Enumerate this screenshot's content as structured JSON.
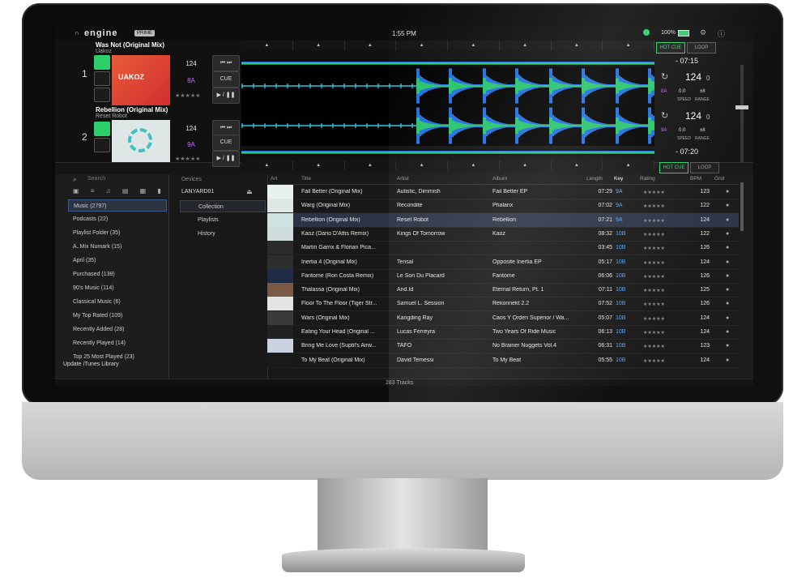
{
  "app": {
    "logo": "engine",
    "logo_tag": "PRIME",
    "clock": "1:55 PM",
    "battery": "100%"
  },
  "decks": [
    {
      "num": "1",
      "title": "Was Not (Original Mix)",
      "artist": "Uakoz",
      "bpm": "124",
      "key": "8A",
      "cue": "CUE",
      "play": "▶ / ❚❚",
      "time": "- 07:15",
      "bpm_display": "124",
      "bpm_dec": "0",
      "key_label": "8A",
      "speed_val": "0.0",
      "range_val": "±8",
      "speed": "SPEED",
      "range": "RANGE",
      "hotcue": "HOT CUE",
      "loop": "LOOP",
      "art_text": "UAKOZ"
    },
    {
      "num": "2",
      "title": "Rebellion (Original Mix)",
      "artist": "Reset Robot",
      "bpm": "124",
      "key": "9A",
      "cue": "CUE",
      "play": "▶ / ❚❚",
      "time": "- 07:20",
      "bpm_display": "124",
      "bpm_dec": "0",
      "key_label": "9A",
      "speed_val": "0.0",
      "range_val": "±8",
      "speed": "SPEED",
      "range": "RANGE",
      "hotcue": "HOT CUE",
      "loop": "LOOP"
    }
  ],
  "browser": {
    "search_placeholder": "Search",
    "library": [
      "Music (2797)",
      "Podcasts (22)",
      "Playlist Folder (35)",
      "A..Mix Numark (15)",
      "April (35)",
      "Purchased (138)",
      "90's Music (114)",
      "Classical Music (6)",
      "My Top Rated (109)",
      "Recently Added (28)",
      "Recently Played (14)",
      "Top 25 Most Played (23)"
    ],
    "update": "Update iTunes Library",
    "devices_header": "Devices",
    "device_name": "LANYARD01",
    "device_items": [
      "Collection",
      "Playlists",
      "History"
    ],
    "columns": {
      "art": "Art",
      "title": "Title",
      "artist": "Artist",
      "album": "Album",
      "length": "Length",
      "key": "Key",
      "rating": "Rating",
      "bpm": "BPM",
      "grid": "Grid"
    },
    "tracks": [
      {
        "title": "Fail Better (Original Mix)",
        "artist": "Autistic, Dimmish",
        "album": "Fail Better EP",
        "length": "07:29",
        "key": "9A",
        "bpm": "123"
      },
      {
        "title": "Warg (Original Mix)",
        "artist": "Recondite",
        "album": "Phalanx",
        "length": "07:02",
        "key": "9A",
        "bpm": "122"
      },
      {
        "title": "Rebellion (Original Mix)",
        "artist": "Reset Robot",
        "album": "Rebellion",
        "length": "07:21",
        "key": "9A",
        "bpm": "124"
      },
      {
        "title": "Kaoz (Dario D'Attis Remix)",
        "artist": "Kings Of Tomorrow",
        "album": "Kaoz",
        "length": "08:32",
        "key": "10B",
        "bpm": "122"
      },
      {
        "title": "Martin Garrix & Florian Pica...",
        "artist": "",
        "album": "",
        "length": "03:45",
        "key": "10B",
        "bpm": "126"
      },
      {
        "title": "Inertia 4 (Original Mix)",
        "artist": "Tensal",
        "album": "Opposite Inertia EP",
        "length": "05:17",
        "key": "10B",
        "bpm": "124"
      },
      {
        "title": "Fantome (Ron Costa Remix)",
        "artist": "Le Son Du Placard",
        "album": "Fantome",
        "length": "06:06",
        "key": "10B",
        "bpm": "126"
      },
      {
        "title": "Thalassa (Original Mix)",
        "artist": "And.Id",
        "album": "Eternal Return, Pt. 1",
        "length": "07:11",
        "key": "10B",
        "bpm": "125"
      },
      {
        "title": "Floor To The Floor (Tiger Str...",
        "artist": "Samuel L. Session",
        "album": "Rekonnekt 2.2",
        "length": "07:52",
        "key": "10B",
        "bpm": "126"
      },
      {
        "title": "Wars (Original Mix)",
        "artist": "Kangding Ray",
        "album": "Caos Y Orden Superior / Wa...",
        "length": "05:07",
        "key": "10B",
        "bpm": "124"
      },
      {
        "title": "Eating  Your Head (Original ...",
        "artist": "Lucas Ferreyra",
        "album": "Two Years Of Ride Music",
        "length": "06:13",
        "key": "10B",
        "bpm": "124"
      },
      {
        "title": "Bring Me Love (Suptil's Airw...",
        "artist": "TAFO",
        "album": "No Brainer Nuggets Vol.4",
        "length": "06:31",
        "key": "10B",
        "bpm": "123"
      },
      {
        "title": "To My Beat (Original Mix)",
        "artist": "David Temessi",
        "album": "To My Beat",
        "length": "05:55",
        "key": "10B",
        "bpm": "124"
      }
    ],
    "selected_track": 2,
    "footer": "283 Tracks",
    "rating": "★★★★★"
  },
  "colors": {
    "accent": "#2ccf6a",
    "wave_blue": "#1f6fe0",
    "wave_green": "#27c46a",
    "key_purple": "#b86ef0",
    "key_blue": "#5aa0e8"
  }
}
